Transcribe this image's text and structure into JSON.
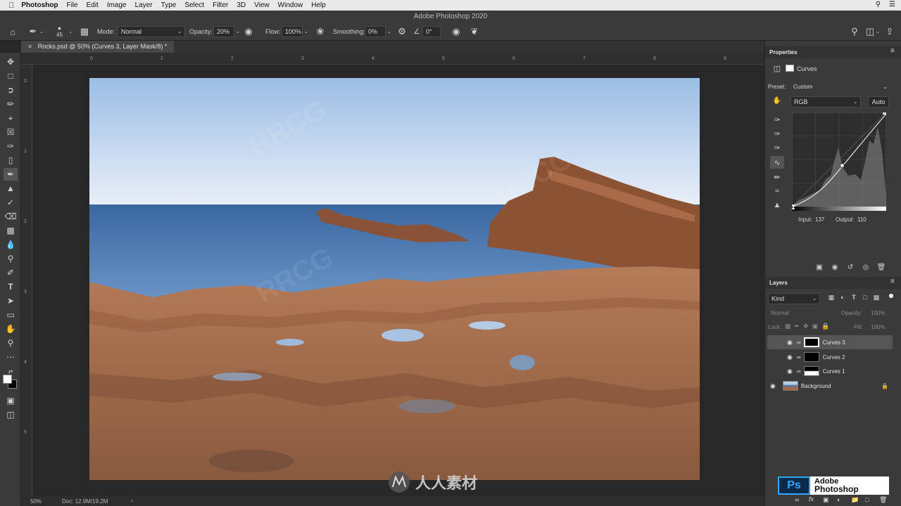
{
  "os_menu": {
    "apple": "",
    "app": "Photoshop",
    "items": [
      "File",
      "Edit",
      "Image",
      "Layer",
      "Type",
      "Select",
      "Filter",
      "3D",
      "View",
      "Window",
      "Help"
    ]
  },
  "window": {
    "title": "Adobe Photoshop 2020"
  },
  "options": {
    "brush_size": "45",
    "mode_label": "Mode:",
    "mode_value": "Normal",
    "opacity_label": "Opacity:",
    "opacity_value": "20%",
    "flow_label": "Flow:",
    "flow_value": "100%",
    "smoothing_label": "Smoothing:",
    "smoothing_value": "0%",
    "angle_value": "0°"
  },
  "document": {
    "tab_label": "Rocks.psd @ 50% (Curves 3, Layer Mask/8) *",
    "close": "×"
  },
  "rulers": {
    "top": [
      "0",
      "1",
      "2",
      "3",
      "4",
      "5",
      "6",
      "7",
      "8",
      "9"
    ],
    "left": [
      "0",
      "1",
      "2",
      "3",
      "4",
      "5"
    ]
  },
  "status": {
    "zoom": "50%",
    "doc": "Doc: 12.9M/19.2M",
    "arrow": "›"
  },
  "properties": {
    "title": "Properties",
    "adjustment": "Curves",
    "preset_label": "Preset:",
    "preset_value": "Custom",
    "channel": "RGB",
    "auto": "Auto",
    "input_label": "Input:",
    "input_value": "137",
    "output_label": "Output:",
    "output_value": "110"
  },
  "layers": {
    "title": "Layers",
    "kind": "Kind",
    "blend": "Normal",
    "opacity_label": "Opacity:",
    "opacity_value": "100%",
    "lock_label": "Lock:",
    "fill_label": "Fill:",
    "fill_value": "100%",
    "items": [
      {
        "name": "Curves 3",
        "selected": true
      },
      {
        "name": "Curves 2",
        "selected": false
      },
      {
        "name": "Curves 1",
        "selected": false
      },
      {
        "name": "Background",
        "selected": false
      }
    ]
  },
  "branding": {
    "ps": "Ps",
    "line1": "Adobe",
    "line2": "Photoshop"
  },
  "colors": {
    "accent": "#1c8cff",
    "panel": "#3a3a3a",
    "sky_top": "#9bbde5",
    "sea": "#3f6fa6",
    "rock": "#a0684a"
  }
}
